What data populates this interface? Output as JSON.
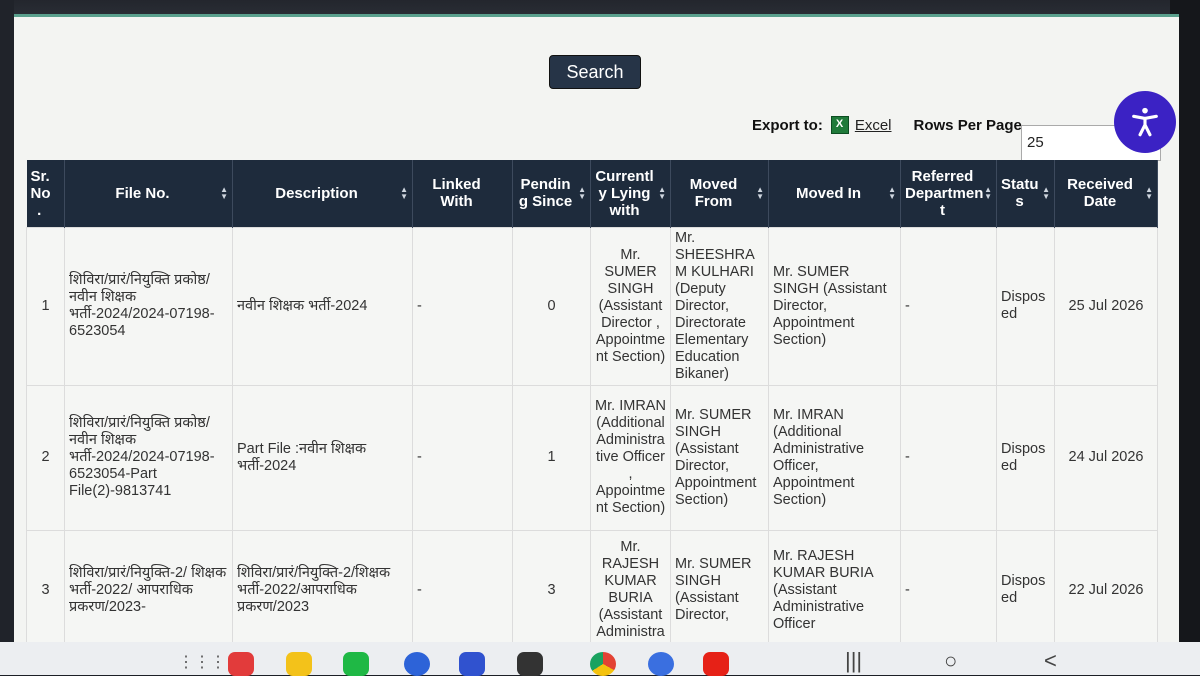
{
  "toolbar": {
    "search_label": "Search",
    "export_label": "Export to:",
    "excel_label": "Excel",
    "rows_per_page_label": "Rows Per Page",
    "rows_per_page_value": "25"
  },
  "table": {
    "headers": [
      "Sr. No .",
      "File No.",
      "Description",
      "Linked With",
      "Pendin g Since",
      "Currentl y Lying with",
      "Moved From",
      "Moved In",
      "Referred Departmen t",
      "Statu s",
      "Received Date"
    ],
    "rows": [
      [
        "1",
        "शिविरा/प्रारं/नियुक्ति प्रकोष्ठ/ नवीन शिक्षक भर्ती-2024/2024-07198- 6523054",
        "नवीन शिक्षक भर्ती-2024",
        "-",
        "0",
        "Mr. SUMER SINGH (Assistant Director , Appointme nt Section)",
        "Mr. SHEESHRA M KULHARI (Deputy Director, Directorate Elementary Education Bikaner)",
        "Mr. SUMER SINGH (Assistant Director, Appointment Section)",
        "-",
        "Dispos ed",
        "25 Jul 2026"
      ],
      [
        "2",
        "शिविरा/प्रारं/नियुक्ति प्रकोष्ठ/ नवीन शिक्षक भर्ती-2024/2024-07198- 6523054-Part File(2)-9813741",
        "Part File :नवीन शिक्षक भर्ती-2024",
        "-",
        "1",
        "Mr. IMRAN (Additional Administra tive Officer , Appointme nt Section)",
        "Mr. SUMER SINGH (Assistant Director, Appointment Section)",
        "Mr. IMRAN (Additional Administrative Officer, Appointment Section)",
        "-",
        "Dispos ed",
        "24 Jul 2026"
      ],
      [
        "3",
        "शिविरा/प्रारं/नियुक्ति-2/ शिक्षक भर्ती-2022/ आपराधिक प्रकरण/2023-",
        "शिविरा/प्रारं/नियुक्ति-2/शिक्षक भर्ती-2022/आपराधिक प्रकरण/2023",
        "-",
        "3",
        "Mr. RAJESH KUMAR BURIA (Assistant Administra",
        "Mr. SUMER SINGH (Assistant Director,",
        "Mr. RAJESH KUMAR BURIA (Assistant Administrative Officer",
        "-",
        "Dispos ed",
        "22 Jul 2026"
      ]
    ]
  },
  "colors": {
    "header_bg": "#1e2b3c",
    "accent": "#3b22c4",
    "excel": "#1f7a3a"
  },
  "taskbar_icons": [
    "apps-grid-icon",
    "red-app-icon",
    "notes-icon",
    "phone-icon",
    "messages-icon",
    "browser-icon",
    "camera-icon",
    "chrome-icon",
    "settings-icon",
    "youtube-icon"
  ]
}
